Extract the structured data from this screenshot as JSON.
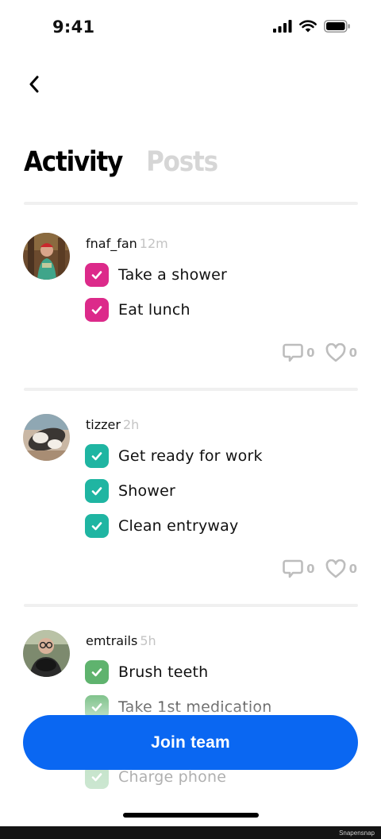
{
  "status_bar": {
    "time": "9:41"
  },
  "tabs": [
    {
      "label": "Activity",
      "active": true
    },
    {
      "label": "Posts",
      "active": false
    }
  ],
  "posts": [
    {
      "username": "fnaf_fan",
      "time_ago": "12m",
      "check_color": "#dc2a8a",
      "tasks": [
        "Take a shower",
        "Eat lunch"
      ],
      "comments": "0",
      "likes": "0"
    },
    {
      "username": "tizzer",
      "time_ago": "2h",
      "check_color": "#1fb5a2",
      "tasks": [
        "Get ready for work",
        "Shower",
        "Clean entryway"
      ],
      "comments": "0",
      "likes": "0"
    },
    {
      "username": "emtrails",
      "time_ago": "5h",
      "check_color": "#5fb36e",
      "tasks": [
        "Brush teeth",
        "Take 1st medication",
        "Charge phone"
      ]
    }
  ],
  "join_button": {
    "label": "Join team"
  },
  "watermark": "Snapensnap",
  "colors": {
    "accent": "#0a67f2",
    "muted": "#bdbdbd"
  },
  "icons": [
    "chevron-left-icon",
    "comment-icon",
    "heart-icon",
    "check-icon",
    "signal-icon",
    "wifi-icon",
    "battery-icon"
  ]
}
